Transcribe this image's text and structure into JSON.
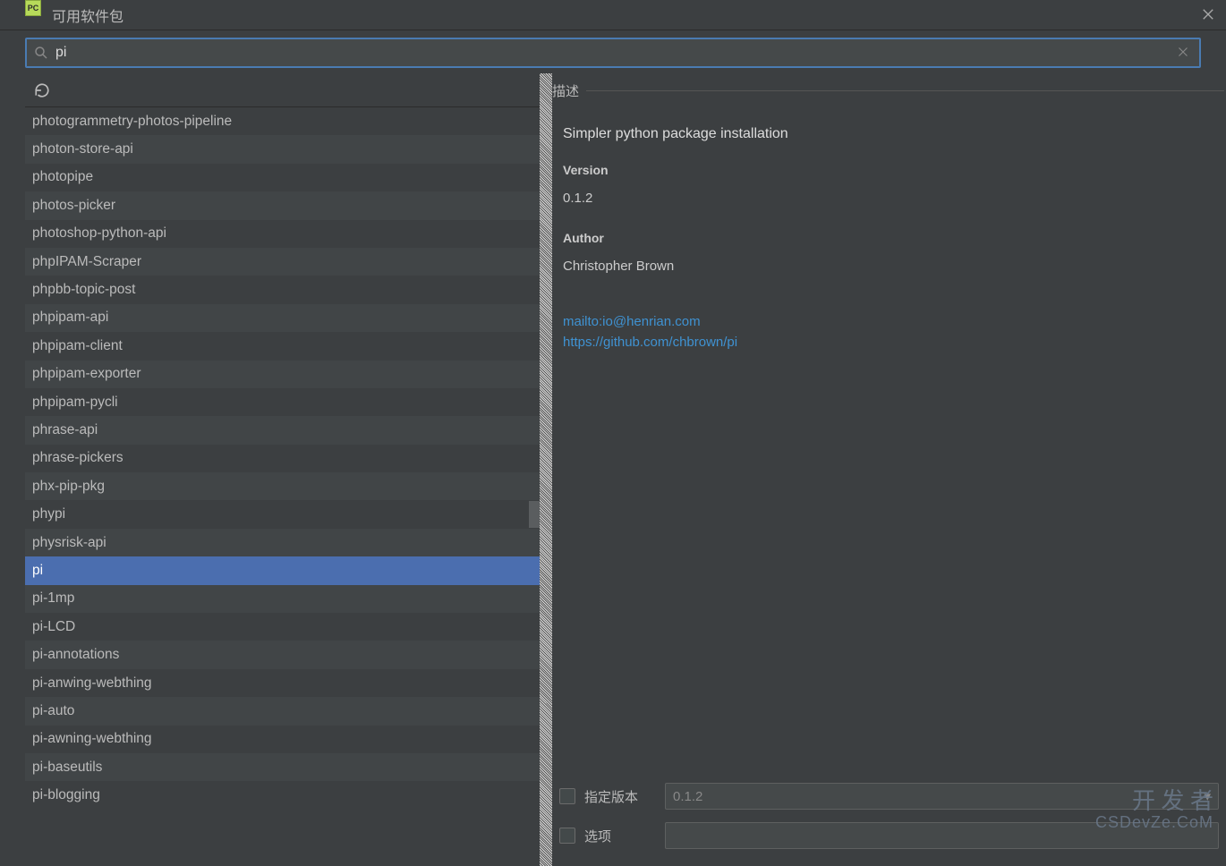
{
  "window": {
    "title": "可用软件包"
  },
  "search": {
    "value": "pi"
  },
  "packages": [
    "photogrammetry-photos-pipeline",
    "photon-store-api",
    "photopipe",
    "photos-picker",
    "photoshop-python-api",
    "phpIPAM-Scraper",
    "phpbb-topic-post",
    "phpipam-api",
    "phpipam-client",
    "phpipam-exporter",
    "phpipam-pycli",
    "phrase-api",
    "phrase-pickers",
    "phx-pip-pkg",
    "phypi",
    "physrisk-api",
    "pi",
    "pi-1mp",
    "pi-LCD",
    "pi-annotations",
    "pi-anwing-webthing",
    "pi-auto",
    "pi-awning-webthing",
    "pi-baseutils",
    "pi-blogging"
  ],
  "selected_index": 16,
  "description": {
    "header": "描述",
    "summary": "Simpler python package installation",
    "version_label": "Version",
    "version_value": "0.1.2",
    "author_label": "Author",
    "author_value": "Christopher Brown",
    "links": [
      "mailto:io@henrian.com",
      "https://github.com/chbrown/pi"
    ]
  },
  "controls": {
    "specify_version_label": "指定版本",
    "specify_version_value": "0.1.2",
    "options_label": "选项"
  },
  "watermark": {
    "line1": "开 发 者",
    "line2": "CSDevZe.CoM"
  }
}
